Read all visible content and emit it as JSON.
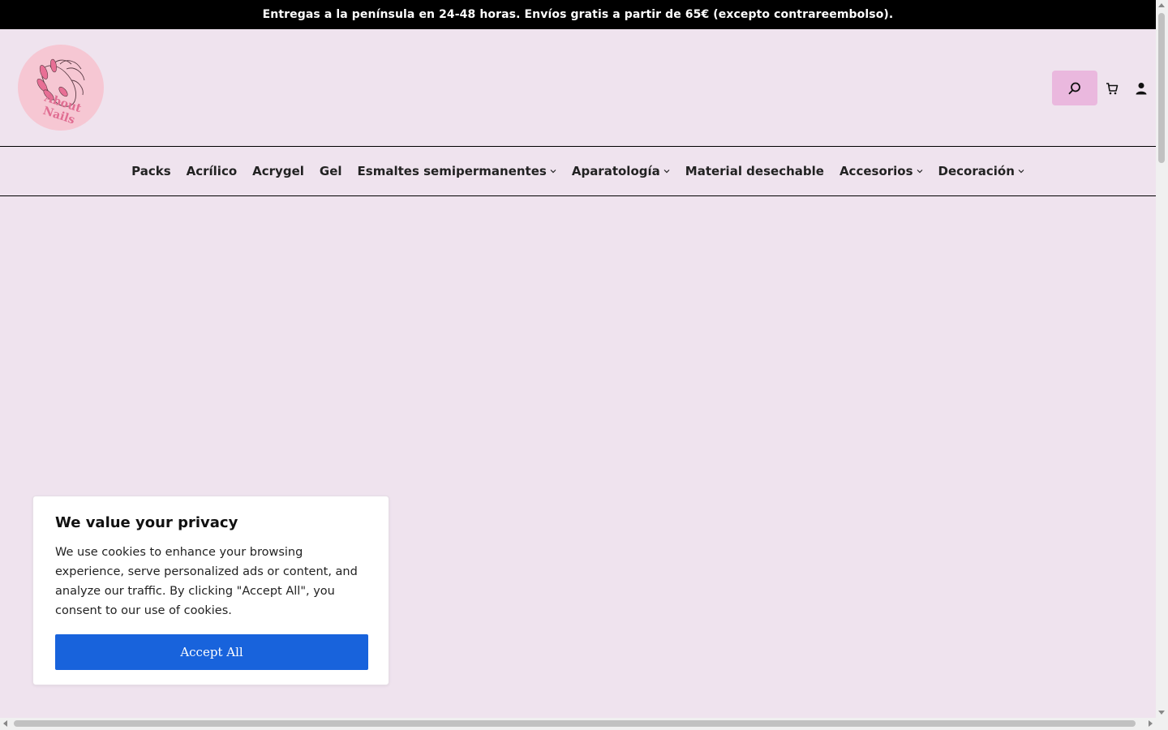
{
  "announcement": "Entregas a la península en 24-48 horas. Envíos gratis a partir de 65€ (excepto contrareembolso).",
  "brand": {
    "logo_text": "About Nails"
  },
  "header": {
    "search_icon": "search-icon",
    "cart_icon": "cart-icon",
    "account_icon": "account-icon",
    "search_button_color": "#eab8de"
  },
  "nav": {
    "items": [
      {
        "label": "Packs",
        "has_dropdown": false
      },
      {
        "label": "Acrílico",
        "has_dropdown": false
      },
      {
        "label": "Acrygel",
        "has_dropdown": false
      },
      {
        "label": "Gel",
        "has_dropdown": false
      },
      {
        "label": "Esmaltes semipermanentes",
        "has_dropdown": true
      },
      {
        "label": "Aparatología",
        "has_dropdown": true
      },
      {
        "label": "Material desechable",
        "has_dropdown": false
      },
      {
        "label": "Accesorios",
        "has_dropdown": true
      },
      {
        "label": "Decoración",
        "has_dropdown": true
      }
    ]
  },
  "cookie": {
    "title": "We value your privacy",
    "body": "We use cookies to enhance your browsing experience, serve personalized ads or content, and analyze our traffic. By clicking \"Accept All\", you consent to our use of cookies.",
    "accept_label": "Accept All",
    "accept_color": "#1863dc"
  },
  "colors": {
    "page_background": "#efe3ee",
    "announcement_background": "#000000"
  }
}
